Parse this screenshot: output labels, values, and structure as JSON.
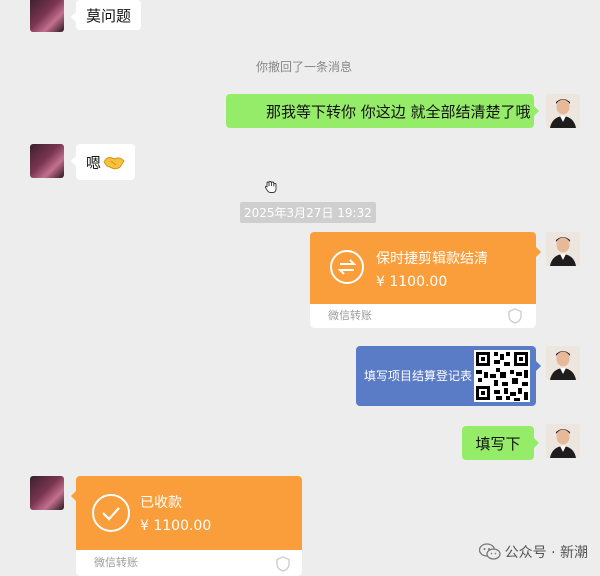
{
  "messages": {
    "m1_text": "莫问题",
    "recall_notice": "你撤回了一条消息",
    "m2_text": "那我等下转你  你这边 就全部结清楚了哦",
    "m3_text": "嗯",
    "timestamp": "2025年3月27日 19:32",
    "m4_transfer": {
      "title": "保时捷剪辑款结清",
      "amount": "¥ 1100.00",
      "footer": "微信转账"
    },
    "m5_card_text": "填写项目结算登记表",
    "m6_text": "填写下",
    "m7_transfer": {
      "title": "已收款",
      "amount": "¥ 1100.00",
      "footer": "微信转账"
    }
  },
  "watermark": {
    "text": "公众号 · 新潮"
  },
  "colors": {
    "background": "#ededed",
    "outgoing_bubble": "#95ec69",
    "transfer": "#fa9d3b",
    "card": "#5a7bc5"
  },
  "icons": [
    "handshake-emoji",
    "hand-cursor-icon",
    "transfer-arrows-icon",
    "check-circle-icon",
    "shield-icon",
    "wechat-logo-icon",
    "qr-code-icon"
  ]
}
